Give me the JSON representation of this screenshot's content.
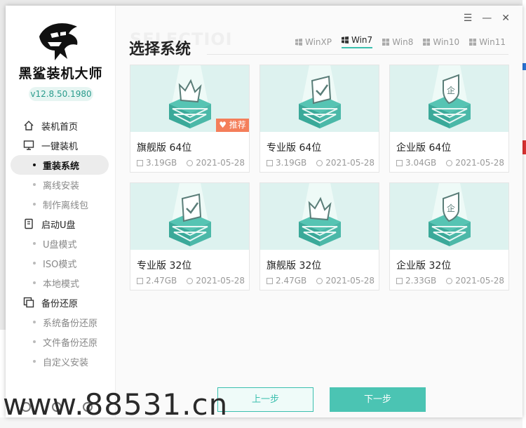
{
  "app": {
    "name": "黑鲨装机大师",
    "version": "v12.8.50.1980"
  },
  "sidebar": {
    "groups": [
      {
        "label": "装机首页",
        "icon": "home-icon"
      },
      {
        "label": "一键装机",
        "icon": "monitor-icon",
        "items": [
          "重装系统",
          "离线安装",
          "制作离线包"
        ]
      },
      {
        "label": "启动U盘",
        "icon": "usb-icon",
        "items": [
          "U盘模式",
          "ISO模式",
          "本地模式"
        ]
      },
      {
        "label": "备份还原",
        "icon": "backup-icon",
        "items": [
          "系统备份还原",
          "文件备份还原",
          "自定义安装"
        ]
      }
    ],
    "active_item": "重装系统"
  },
  "window_controls": [
    "☰",
    "—",
    "✕"
  ],
  "main": {
    "title": "选择系统",
    "bg_title": "SELECTIOI",
    "tabs": [
      "WinXP",
      "Win7",
      "Win8",
      "Win10",
      "Win11"
    ],
    "active_tab": "Win7"
  },
  "cards": [
    {
      "name": "旗舰版 64位",
      "size": "3.19GB",
      "date": "2021-05-28",
      "badge": "推荐",
      "icon": "crown-icon"
    },
    {
      "name": "专业版 64位",
      "size": "3.19GB",
      "date": "2021-05-28",
      "icon": "check-icon"
    },
    {
      "name": "企业版 64位",
      "size": "3.04GB",
      "date": "2021-05-28",
      "icon": "shield-icon"
    },
    {
      "name": "专业版 32位",
      "size": "2.47GB",
      "date": "2021-05-28",
      "icon": "check-icon"
    },
    {
      "name": "旗舰版 32位",
      "size": "2.47GB",
      "date": "2021-05-28",
      "icon": "crown-icon"
    },
    {
      "name": "企业版 32位",
      "size": "2.33GB",
      "date": "2021-05-28",
      "icon": "shield-icon"
    }
  ],
  "buttons": {
    "prev": "上一步",
    "next": "下一步"
  },
  "watermark": "www.88531.cn",
  "colors": {
    "accent": "#4bc4b3",
    "badge": "#f47e5a",
    "thumb_bg": "#ddf2ef"
  }
}
